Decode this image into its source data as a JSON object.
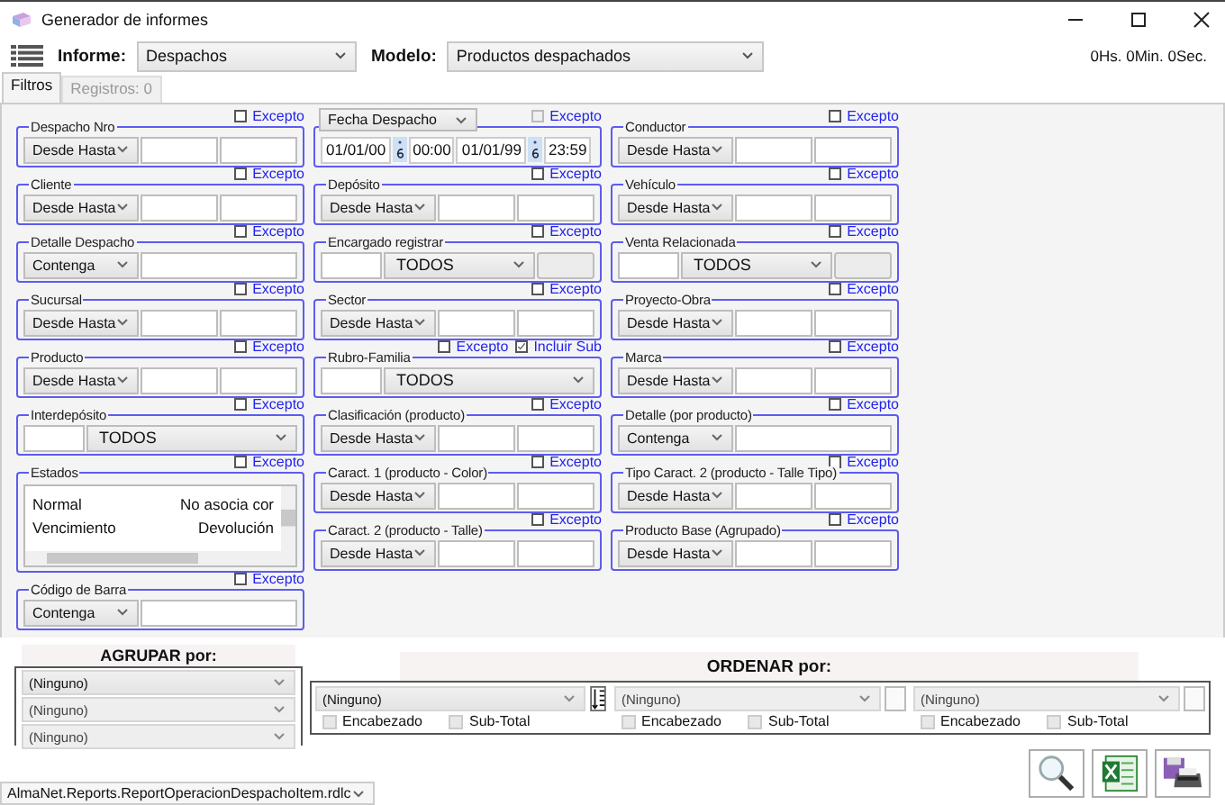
{
  "window": {
    "title": "Generador de informes"
  },
  "toolbar": {
    "informe_label": "Informe:",
    "informe": "Despachos",
    "modelo_label": "Modelo:",
    "modelo": "Productos despachados",
    "timer": "0Hs. 0Min. 0Sec."
  },
  "tabs": [
    {
      "label": "Filtros",
      "selected": true
    },
    {
      "label": "Registros: 0",
      "selected": false
    }
  ],
  "filter_columns": [
    [
      {
        "kind": "range",
        "label": "Despacho Nro",
        "select": "Desde Hasta",
        "except": {
          "label": "Excepto",
          "checked": false,
          "disabled": false
        }
      },
      {
        "kind": "range",
        "label": "Cliente",
        "select": "Desde Hasta",
        "except": {
          "label": "Excepto",
          "checked": false,
          "disabled": false
        }
      },
      {
        "kind": "contains",
        "label": "Detalle Despacho",
        "select": "Contenga",
        "except": {
          "label": "Excepto",
          "checked": false,
          "disabled": false
        }
      },
      {
        "kind": "range",
        "label": "Sucursal",
        "select": "Desde Hasta",
        "except": {
          "label": "Excepto",
          "checked": false,
          "disabled": false
        }
      },
      {
        "kind": "range",
        "label": "Producto",
        "select": "Desde Hasta",
        "except": {
          "label": "Excepto",
          "checked": false,
          "disabled": false
        }
      },
      {
        "kind": "combo",
        "label": "Interdepósito",
        "select": "TODOS",
        "extra_box": false,
        "except": {
          "label": "Excepto",
          "checked": false,
          "disabled": false
        }
      },
      {
        "kind": "list",
        "label": "Estados",
        "items": [
          [
            "Normal",
            "No asocia cor"
          ],
          [
            "Vencimiento",
            "Devolución"
          ]
        ],
        "except": {
          "label": "Excepto",
          "checked": false,
          "disabled": false
        }
      },
      {
        "kind": "contains",
        "label": "Código de Barra",
        "select": "Contenga",
        "except": {
          "label": "Excepto",
          "checked": false,
          "disabled": false
        }
      }
    ],
    [
      {
        "kind": "date",
        "select": "Fecha Despacho",
        "from_date": "01/01/00",
        "from_time": "00:00",
        "to_date": "01/01/99",
        "to_time": "23:59",
        "except": {
          "label": "Excepto",
          "checked": false,
          "disabled": true
        }
      },
      {
        "kind": "range",
        "label": "Depósito",
        "select": "Desde Hasta",
        "except": {
          "label": "Excepto",
          "checked": false,
          "disabled": false
        }
      },
      {
        "kind": "combo",
        "label": "Encargado registrar",
        "select": "TODOS",
        "extra_box": true,
        "except": {
          "label": "Excepto",
          "checked": false,
          "disabled": false
        }
      },
      {
        "kind": "range",
        "label": "Sector",
        "select": "Desde Hasta",
        "except": {
          "label": "Excepto",
          "checked": false,
          "disabled": false
        }
      },
      {
        "kind": "combo",
        "label": "Rubro-Familia",
        "select": "TODOS",
        "extra_box": false,
        "include_sub": {
          "label": "Incluir Sub",
          "checked": true
        },
        "except": {
          "label": "Excepto",
          "checked": false,
          "disabled": false
        }
      },
      {
        "kind": "range",
        "label": "Clasificación (producto)",
        "select": "Desde Hasta",
        "except": {
          "label": "Excepto",
          "checked": false,
          "disabled": false
        }
      },
      {
        "kind": "range",
        "label": "Caract. 1 (producto - Color)",
        "select": "Desde Hasta",
        "except": {
          "label": "Excepto",
          "checked": false,
          "disabled": false
        }
      },
      {
        "kind": "range",
        "label": "Caract. 2 (producto - Talle)",
        "select": "Desde Hasta",
        "except": {
          "label": "Excepto",
          "checked": false,
          "disabled": false
        }
      }
    ],
    [
      {
        "kind": "range",
        "label": "Conductor",
        "select": "Desde Hasta",
        "except": {
          "label": "Excepto",
          "checked": false,
          "disabled": false
        }
      },
      {
        "kind": "range",
        "label": "Vehículo",
        "select": "Desde Hasta",
        "except": {
          "label": "Excepto",
          "checked": false,
          "disabled": false
        }
      },
      {
        "kind": "combo",
        "label": "Venta Relacionada",
        "select": "TODOS",
        "extra_box": true,
        "except": {
          "label": "Excepto",
          "checked": false,
          "disabled": false
        }
      },
      {
        "kind": "range",
        "label": "Proyecto-Obra",
        "select": "Desde Hasta",
        "except": {
          "label": "Excepto",
          "checked": false,
          "disabled": false
        }
      },
      {
        "kind": "range",
        "label": "Marca",
        "select": "Desde Hasta",
        "except": {
          "label": "Excepto",
          "checked": false,
          "disabled": false
        }
      },
      {
        "kind": "contains",
        "label": "Detalle (por producto)",
        "select": "Contenga",
        "except": {
          "label": "Excepto",
          "checked": false,
          "disabled": false
        }
      },
      {
        "kind": "range",
        "label": "Tipo Caract. 2 (producto - Talle Tipo)",
        "select": "Desde Hasta",
        "except": {
          "label": "Excepto",
          "checked": false,
          "disabled": false
        }
      },
      {
        "kind": "range",
        "label": "Producto Base (Agrupado)",
        "select": "Desde Hasta",
        "except": {
          "label": "Excepto",
          "checked": false,
          "disabled": false
        }
      }
    ]
  ],
  "grouping": {
    "title": "AGRUPAR por:",
    "selects": [
      {
        "value": "(Ninguno)",
        "disabled": false
      },
      {
        "value": "(Ninguno)",
        "disabled": true
      },
      {
        "value": "(Ninguno)",
        "disabled": true
      }
    ]
  },
  "ordering": {
    "title": "ORDENAR  por:",
    "items": [
      {
        "value": "(Ninguno)",
        "disabled": false,
        "header": {
          "label": "Encabezado",
          "checked": false
        },
        "subtotal": {
          "label": "Sub-Total",
          "checked": false
        }
      },
      {
        "value": "(Ninguno)",
        "disabled": true,
        "header": {
          "label": "Encabezado",
          "checked": false
        },
        "subtotal": {
          "label": "Sub-Total",
          "checked": false
        }
      },
      {
        "value": "(Ninguno)",
        "disabled": true,
        "header": {
          "label": "Encabezado",
          "checked": false
        },
        "subtotal": {
          "label": "Sub-Total",
          "checked": false
        }
      }
    ]
  },
  "report_file": "AlmaNet.Reports.ReportOperacionDespachoItem.rdlc"
}
